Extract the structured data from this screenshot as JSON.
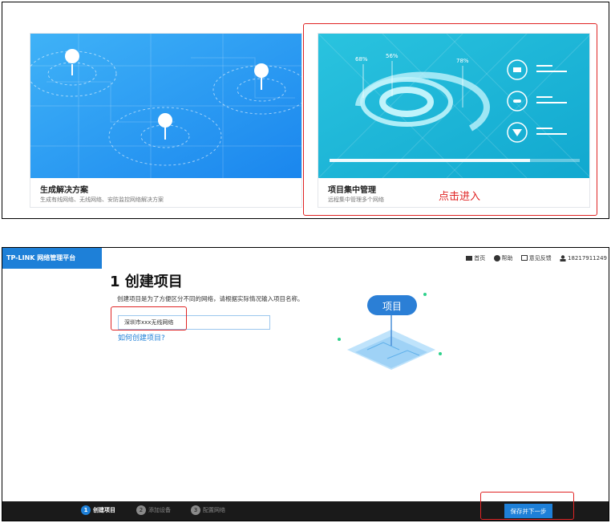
{
  "top": {
    "card1": {
      "title": "生成解决方案",
      "desc": "生成有线网络、无线网络、安防监控网络解决方案"
    },
    "card2": {
      "title": "项目集中管理",
      "desc": "远程集中管理多个网络",
      "chart_labels": [
        "68%",
        "56%",
        "78%"
      ],
      "icons": [
        "router-icon",
        "switch-icon",
        "shield-icon"
      ]
    },
    "click_hint": "点击进入"
  },
  "app": {
    "logo": "TP-LINK 网络管理平台",
    "nav": {
      "home": "首页",
      "help": "帮助",
      "feedback": "意见反馈",
      "user": "18217911249"
    },
    "page_title": "1 创建项目",
    "hint": "创建项目是为了方便区分不同的网络，请根据实际情况输入项目名称。",
    "input_value": "深圳市xxx无线网络",
    "help_link": "如何创建项目?",
    "illustration_label": "项目",
    "steps": [
      {
        "num": "1",
        "label": "创建项目"
      },
      {
        "num": "2",
        "label": "添加设备"
      },
      {
        "num": "3",
        "label": "配置网络"
      }
    ],
    "save_button": "保存并下一步"
  },
  "colors": {
    "brand": "#1e80d8",
    "alert": "#e02424",
    "footer": "#1a1a1a"
  }
}
